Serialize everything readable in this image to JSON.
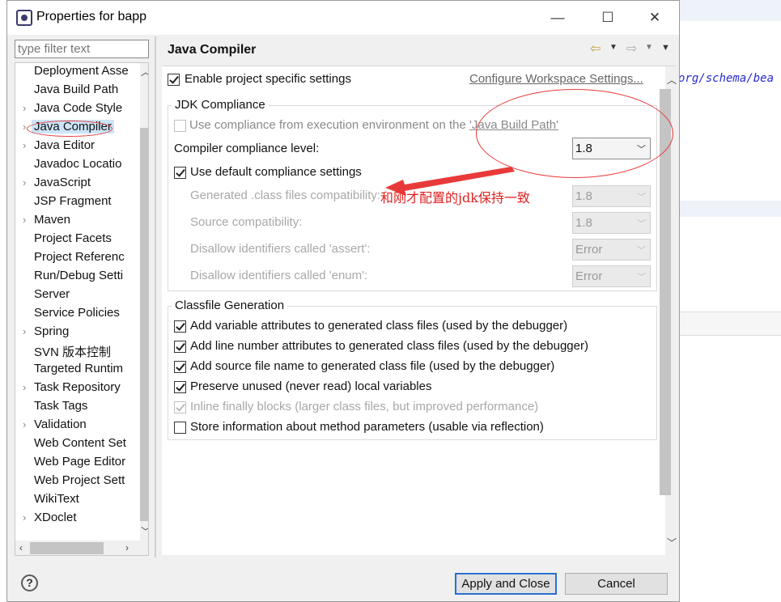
{
  "window": {
    "title": "Properties for bapp",
    "minimize": "—",
    "maximize": "☐",
    "close": "✕"
  },
  "background": {
    "code_fragment": "org/schema/bea"
  },
  "filter": {
    "placeholder": "type filter text"
  },
  "tree": {
    "items": [
      {
        "label": "Deployment Asse",
        "expandable": false
      },
      {
        "label": "Java Build Path",
        "expandable": false
      },
      {
        "label": "Java Code Style",
        "expandable": true
      },
      {
        "label": "Java Compiler",
        "expandable": true,
        "selected": true
      },
      {
        "label": "Java Editor",
        "expandable": true
      },
      {
        "label": "Javadoc Locatio",
        "expandable": false
      },
      {
        "label": "JavaScript",
        "expandable": true
      },
      {
        "label": "JSP Fragment",
        "expandable": false
      },
      {
        "label": "Maven",
        "expandable": true
      },
      {
        "label": "Project Facets",
        "expandable": false
      },
      {
        "label": "Project Referenc",
        "expandable": false
      },
      {
        "label": "Run/Debug Setti",
        "expandable": false
      },
      {
        "label": "Server",
        "expandable": false
      },
      {
        "label": "Service Policies",
        "expandable": false
      },
      {
        "label": "Spring",
        "expandable": true
      },
      {
        "label": "SVN 版本控制",
        "expandable": false
      },
      {
        "label": "Targeted Runtim",
        "expandable": false
      },
      {
        "label": "Task Repository",
        "expandable": true
      },
      {
        "label": "Task Tags",
        "expandable": false
      },
      {
        "label": "Validation",
        "expandable": true
      },
      {
        "label": "Web Content Set",
        "expandable": false
      },
      {
        "label": "Web Page Editor",
        "expandable": false
      },
      {
        "label": "Web Project Sett",
        "expandable": false
      },
      {
        "label": "WikiText",
        "expandable": false
      },
      {
        "label": "XDoclet",
        "expandable": true
      }
    ]
  },
  "page": {
    "title": "Java Compiler",
    "enable_project_specific": {
      "label": "Enable project specific settings",
      "checked": true
    },
    "configure_workspace_link": "Configure Workspace Settings...",
    "jdk_compliance": {
      "group_title": "JDK Compliance",
      "use_ee_compliance": {
        "label_prefix": "Use compliance from execution environment on the ",
        "link": "'Java Build Path'",
        "checked": false,
        "enabled": false
      },
      "compliance_level_label": "Compiler compliance level:",
      "compliance_level_value": "1.8",
      "use_default_compliance": {
        "label": "Use default compliance settings",
        "checked": true
      },
      "generated_class_label": "Generated .class files compatibility:",
      "generated_class_value": "1.8",
      "source_compat_label": "Source compatibility:",
      "source_compat_value": "1.8",
      "assert_label": "Disallow identifiers called 'assert':",
      "assert_value": "Error",
      "enum_label": "Disallow identifiers called 'enum':",
      "enum_value": "Error"
    },
    "classfile_generation": {
      "group_title": "Classfile Generation",
      "options": [
        {
          "label": "Add variable attributes to generated class files (used by the debugger)",
          "checked": true,
          "enabled": true
        },
        {
          "label": "Add line number attributes to generated class files (used by the debugger)",
          "checked": true,
          "enabled": true
        },
        {
          "label": "Add source file name to generated class file (used by the debugger)",
          "checked": true,
          "enabled": true
        },
        {
          "label": "Preserve unused (never read) local variables",
          "checked": true,
          "enabled": true
        },
        {
          "label": "Inline finally blocks (larger class files, but improved performance)",
          "checked": true,
          "enabled": false
        },
        {
          "label": "Store information about method parameters (usable via reflection)",
          "checked": false,
          "enabled": true
        }
      ]
    }
  },
  "annotation": {
    "text": "和刚才配置的jdk保持一致",
    "color": "#e02020"
  },
  "buttons": {
    "help": "?",
    "apply_close": "Apply and Close",
    "cancel": "Cancel"
  },
  "colors": {
    "selection": "#cce4f7",
    "default_button_border": "#2a6fd1",
    "annotation_red": "#e83a3a"
  }
}
